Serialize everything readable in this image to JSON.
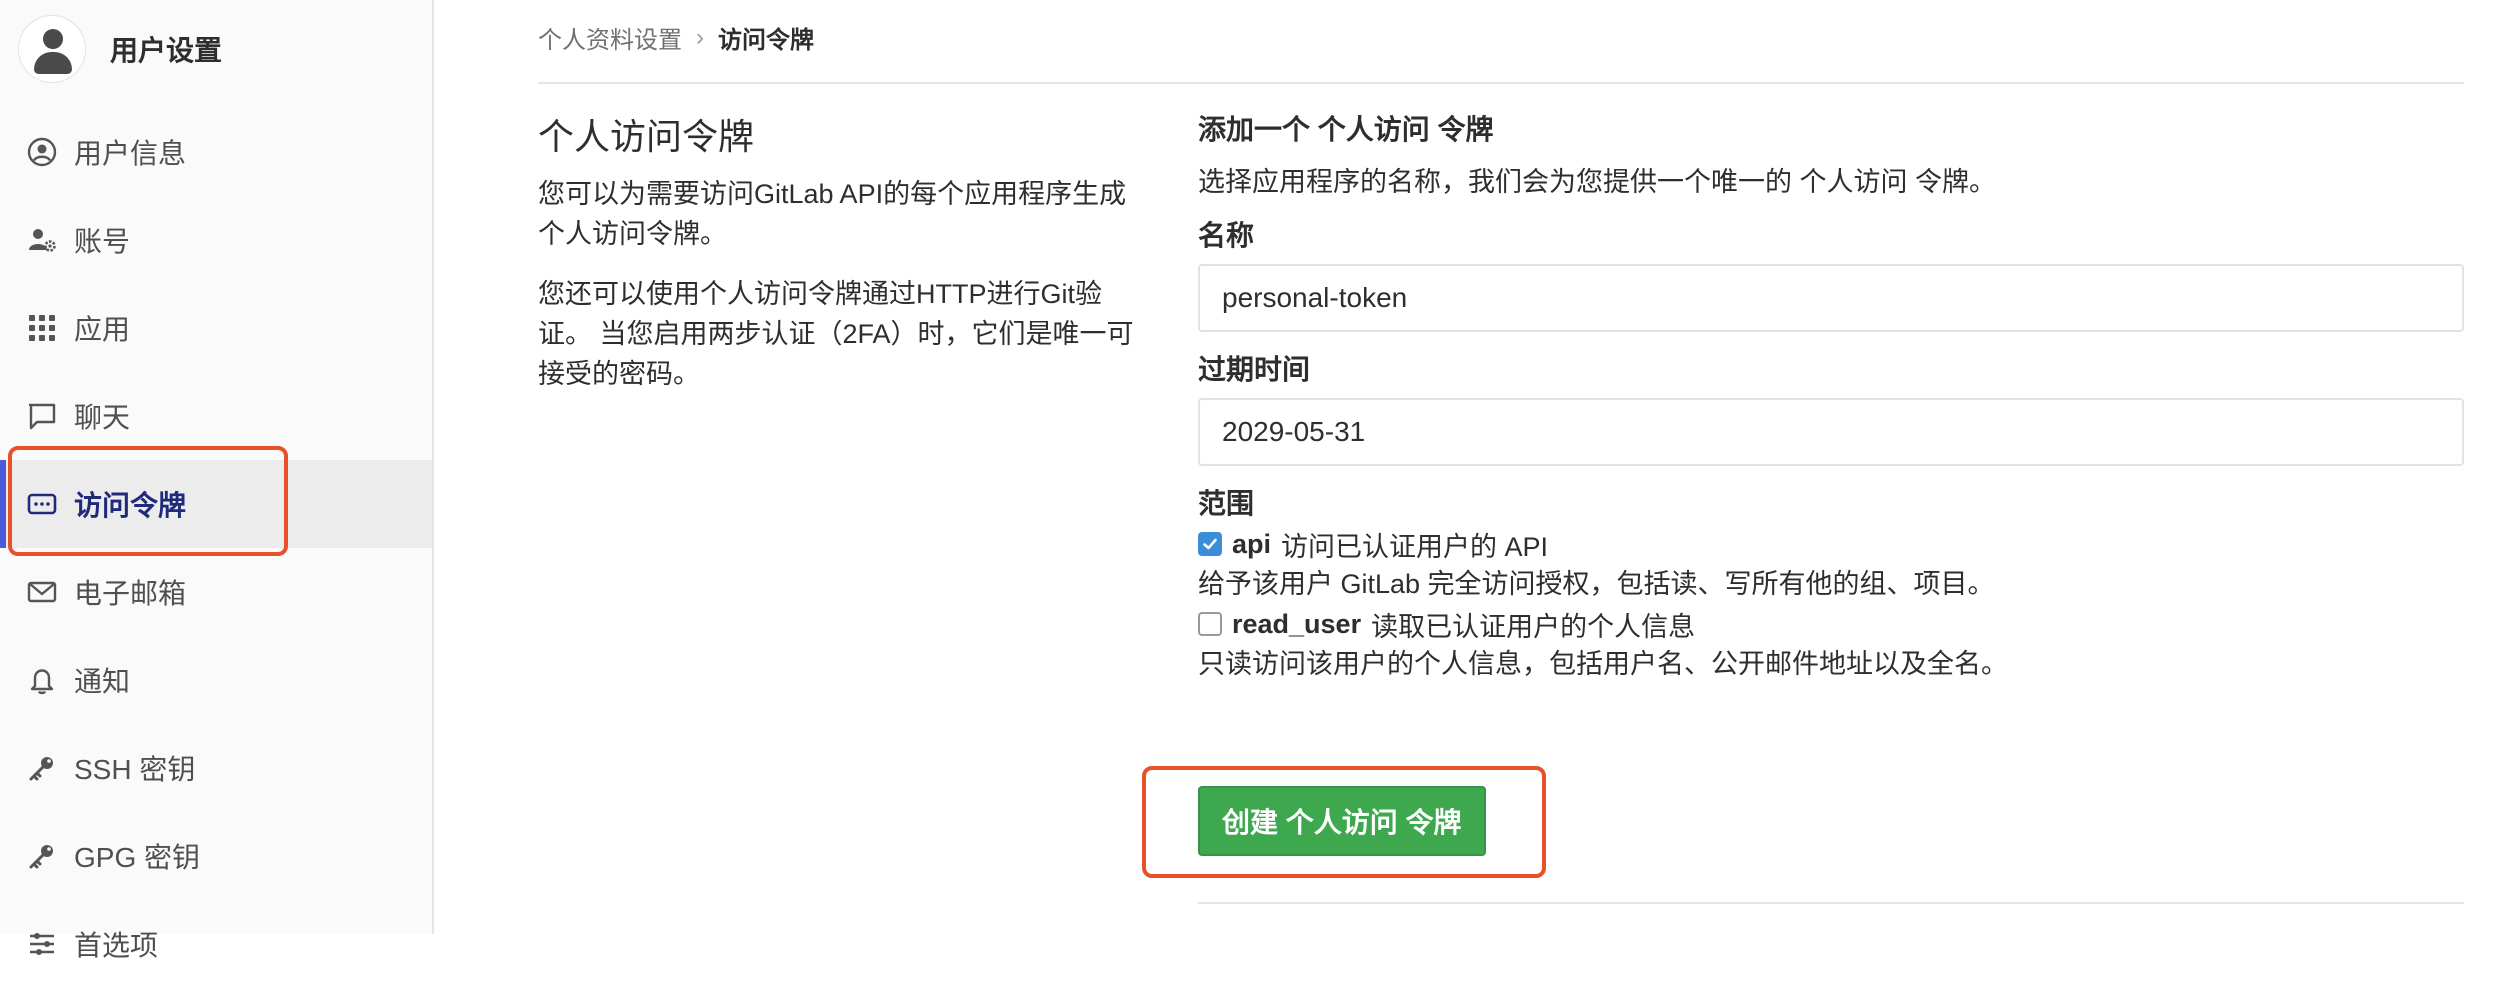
{
  "sidebar": {
    "header": {
      "title": "用户设置"
    },
    "items": [
      {
        "label": "用户信息",
        "icon": "user-circle-icon"
      },
      {
        "label": "账号",
        "icon": "user-gear-icon"
      },
      {
        "label": "应用",
        "icon": "grid-icon"
      },
      {
        "label": "聊天",
        "icon": "chat-icon"
      },
      {
        "label": "访问令牌",
        "icon": "token-icon",
        "active": true
      },
      {
        "label": "电子邮箱",
        "icon": "envelope-icon"
      },
      {
        "label": "通知",
        "icon": "bell-icon"
      },
      {
        "label": "SSH 密钥",
        "icon": "key-icon"
      },
      {
        "label": "GPG 密钥",
        "icon": "key-icon"
      },
      {
        "label": "首选项",
        "icon": "sliders-icon"
      }
    ]
  },
  "breadcrumb": {
    "parent": "个人资料设置",
    "separator": "›",
    "current": "访问令牌"
  },
  "intro": {
    "title": "个人访问令牌",
    "paragraph1": "您可以为需要访问GitLab API的每个应用程序生成个人访问令牌。",
    "paragraph2": "您还可以使用个人访问令牌通过HTTP进行Git验证。 当您启用两步认证（2FA）时，它们是唯一可接受的密码。"
  },
  "form": {
    "title": "添加一个 个人访问 令牌",
    "description": "选择应用程序的名称，我们会为您提供一个唯一的 个人访问 令牌。",
    "name_label": "名称",
    "name_value": "personal-token",
    "expires_label": "过期时间",
    "expires_value": "2029-05-31",
    "scopes_label": "范围",
    "scopes": [
      {
        "name": "api",
        "label": "访问已认证用户的 API",
        "help": "给予该用户 GitLab 完全访问授权，包括读、写所有他的组、项目。",
        "checked": true
      },
      {
        "name": "read_user",
        "label": "读取已认证用户的个人信息",
        "help": "只读访问该用户的个人信息，包括用户名、公开邮件地址以及全名。",
        "checked": false
      }
    ],
    "submit_label": "创建 个人访问 令牌"
  },
  "colors": {
    "accent": "#4b5bd7",
    "highlight": "#e8502a",
    "button": "#3ea84f",
    "checkbox": "#3b8cd9"
  }
}
